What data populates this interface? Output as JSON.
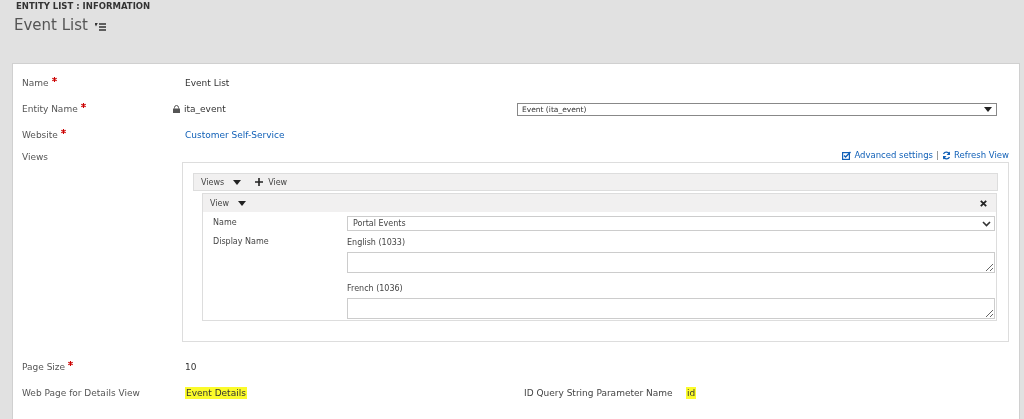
{
  "header": {
    "breadcrumb": "ENTITY LIST : INFORMATION",
    "title": "Event List"
  },
  "fields": [
    {
      "label": "Name",
      "required": true,
      "kind": "text",
      "value": "Event List"
    },
    {
      "label": "Entity Name",
      "required": true,
      "kind": "locked",
      "value": "ita_event",
      "select": "Event (ita_event)"
    },
    {
      "label": "Website",
      "required": true,
      "kind": "link",
      "value": "Customer Self-Service"
    }
  ],
  "views": {
    "label": "Views",
    "advanced": "Advanced settings",
    "refresh": "Refresh View",
    "toolbar_label": "Views",
    "add": "View",
    "view": {
      "title": "View",
      "name_label": "Name",
      "name_value": "Portal Events",
      "display_label": "Display Name",
      "languages": [
        {
          "label": "English (1033)"
        },
        {
          "label": "French (1036)"
        }
      ]
    }
  },
  "page_size": {
    "label": "Page Size",
    "required": true,
    "value": "10"
  },
  "details": {
    "label": "Web Page for Details View",
    "value": "Event Details",
    "highlighted": true,
    "param_label": "ID Query String Parameter Name",
    "param_value": "id",
    "param_highlighted": true
  }
}
